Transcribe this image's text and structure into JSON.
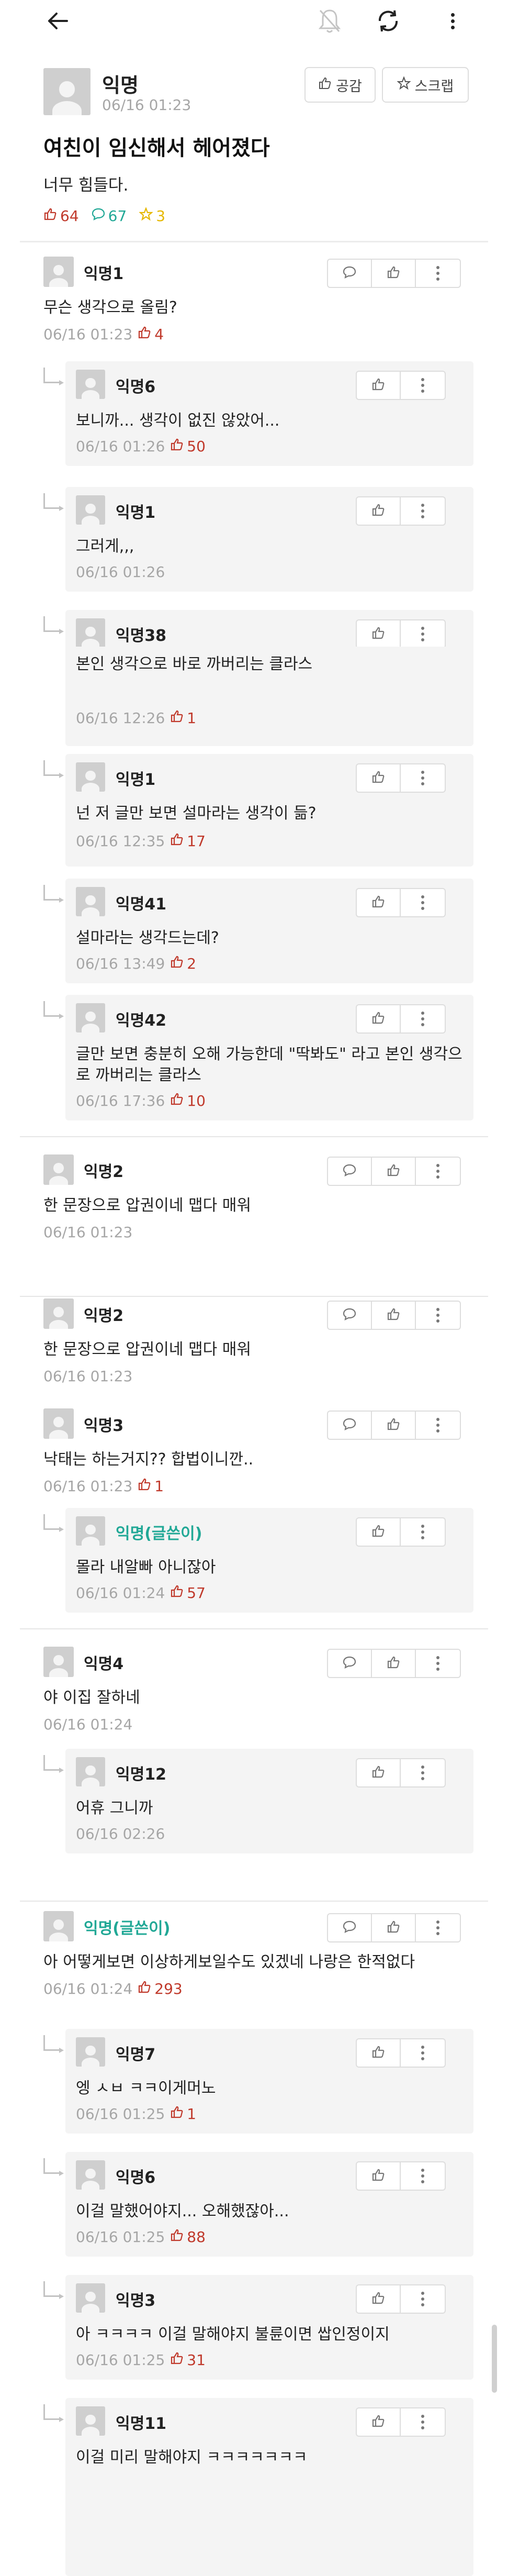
{
  "post": {
    "author": "익명",
    "date": "06/16 01:23",
    "title": "여친이 임신해서 헤어졌다",
    "body": "너무 힘들다.",
    "like_count": "64",
    "comment_count": "67",
    "scrap_count": "3",
    "empathy_label": "공감",
    "scrap_label": "스크랩"
  },
  "comments": [
    {
      "author": "익명1",
      "body": "무슨 생각으로 올림?",
      "date": "06/16 01:23",
      "likes": "4"
    },
    {
      "author": "익명6",
      "body": "보니까... 생각이 없진 않았어...",
      "date": "06/16 01:26",
      "likes": "50"
    },
    {
      "author": "익명1",
      "body": "그러게,,,",
      "date": "06/16 01:26",
      "likes": ""
    },
    {
      "author": "익명38",
      "body": "",
      "date": "",
      "likes": ""
    },
    {
      "author": "",
      "body": "본인 생각으로 바로 까버리는 클라스",
      "date": "06/16 12:26",
      "likes": "1"
    },
    {
      "author": "익명1",
      "body": "넌 저 글만 보면 설마라는 생각이 듦?",
      "date": "06/16 12:35",
      "likes": "17"
    },
    {
      "author": "익명41",
      "body": "설마라는 생각드는데?",
      "date": "06/16 13:49",
      "likes": "2"
    },
    {
      "author": "익명42",
      "body": "글만 보면 충분히 오해 가능한데 \"딱봐도\" 라고 본인 생각으로 까버리는 클라스",
      "date": "06/16 17:36",
      "likes": "10"
    },
    {
      "author": "익명2",
      "body": "한 문장으로 압권이네 맵다 매워",
      "date": "06/16 01:23",
      "likes": ""
    },
    {
      "author": "익명2",
      "body": "한 문장으로 압권이네 맵다 매워",
      "date": "06/16 01:23",
      "likes": ""
    },
    {
      "author": "익명3",
      "body": "낙태는 하는거지?? 합법이니깐..",
      "date": "06/16 01:23",
      "likes": "1"
    },
    {
      "author": "익명(글쓴이)",
      "body": "몰라 내알빠 아니잖아",
      "date": "06/16 01:24",
      "likes": "57"
    },
    {
      "author": "익명4",
      "body": "야 이집 잘하네",
      "date": "06/16 01:24",
      "likes": ""
    },
    {
      "author": "익명12",
      "body": "어휴 그니까",
      "date": "06/16 02:26",
      "likes": ""
    },
    {
      "author": "익명(글쓴이)",
      "body": "아 어떻게보면 이상하게보일수도 있겠네 나랑은 한적없다",
      "date": "06/16 01:24",
      "likes": "293"
    },
    {
      "author": "익명7",
      "body": "엥 ㅅㅂ ㅋㅋ이게머노",
      "date": "06/16 01:25",
      "likes": "1"
    },
    {
      "author": "익명6",
      "body": "이걸 말했어야지... 오해했잖아...",
      "date": "06/16 01:25",
      "likes": "88"
    },
    {
      "author": "익명3",
      "body": "아 ㅋㅋㅋㅋ 이걸 말해야지 불륜이면 쌉인정이지",
      "date": "06/16 01:25",
      "likes": "31"
    },
    {
      "author": "익명11",
      "body": "이걸 미리 말해야지 ㅋㅋㅋㅋㅋㅋㅋ",
      "date": "",
      "likes": ""
    }
  ]
}
